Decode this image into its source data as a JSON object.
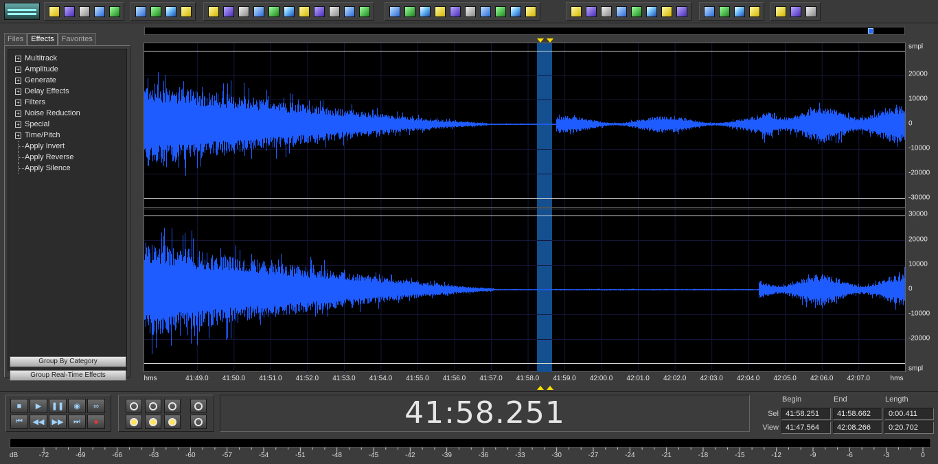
{
  "toolbar": {
    "groups": [
      {
        "icons": [
          "new-file-icon",
          "open-file-icon",
          "save-icon",
          "save-copy-icon",
          "save-all-icon"
        ]
      },
      {
        "icons": [
          "edit-waveform-icon",
          "paint-icon",
          "crop-icon",
          "mixdown-icon"
        ]
      },
      {
        "icons": [
          "envelope-icon",
          "undo-icon",
          "silence-icon",
          "marker-icon",
          "zero-crossing-icon",
          "snap-icon",
          "scan-icon",
          "level-icon",
          "normalize-icon",
          "pan-icon",
          "stretch-icon"
        ]
      },
      {
        "icons": [
          "eq-icon",
          "compressor-icon",
          "noise-icon",
          "echo-icon",
          "filter-icon",
          "reverb-icon",
          "delay-icon",
          "chorus-icon",
          "flanger-icon",
          "pitch-icon"
        ]
      },
      {
        "icons": [
          "spectrum-icon",
          "frequency-icon",
          "phase-icon",
          "analysis-icon",
          "statistics-icon",
          "cd-icon",
          "grid-icon",
          "metronome-icon"
        ]
      },
      {
        "icons": [
          "fx-insert-icon",
          "fx-rack-icon",
          "fx-chain-icon",
          "fx-preset-icon"
        ]
      },
      {
        "icons": [
          "cue-icon",
          "tempo-icon",
          "view-fit-icon"
        ]
      }
    ]
  },
  "panel": {
    "tabs": [
      {
        "label": "Files",
        "active": false
      },
      {
        "label": "Effects",
        "active": true
      },
      {
        "label": "Favorites",
        "active": false
      }
    ],
    "tree": [
      {
        "label": "Multitrack",
        "expandable": true
      },
      {
        "label": "Amplitude",
        "expandable": true
      },
      {
        "label": "Generate",
        "expandable": true
      },
      {
        "label": "Delay Effects",
        "expandable": true
      },
      {
        "label": "Filters",
        "expandable": true
      },
      {
        "label": "Noise Reduction",
        "expandable": true
      },
      {
        "label": "Special",
        "expandable": true
      },
      {
        "label": "Time/Pitch",
        "expandable": true
      },
      {
        "label": "Apply Invert",
        "expandable": false
      },
      {
        "label": "Apply Reverse",
        "expandable": false
      },
      {
        "label": "Apply Silence",
        "expandable": false
      }
    ],
    "buttons": {
      "group_by_category": "Group By Category",
      "group_realtime": "Group Real-Time Effects"
    }
  },
  "waveform": {
    "ruler_unit_left": "hms",
    "ruler_unit_right": "hms",
    "ruler_labels": [
      "41:49.0",
      "41:50.0",
      "41:51.0",
      "41:52.0",
      "41:53.0",
      "41:54.0",
      "41:55.0",
      "41:56.0",
      "41:57.0",
      "41:58.0",
      "41:59.0",
      "42:00.0",
      "42:01.0",
      "42:02.0",
      "42:03.0",
      "42:04.0",
      "42:05.0",
      "42:06.0",
      "42:07.0"
    ],
    "view_start_seconds": 47.564,
    "view_end_seconds": 68.266,
    "selection_start_seconds": 58.251,
    "selection_end_seconds": 58.662,
    "y_unit": "smpl",
    "channel1_ylabels": [
      "20000",
      "10000",
      "0",
      "-10000",
      "-20000",
      "-30000"
    ],
    "channel2_ylabels": [
      "30000",
      "20000",
      "10000",
      "0",
      "-10000",
      "-20000"
    ],
    "waveform_color": "#1f5cff",
    "selection_color": "#14508f"
  },
  "transport": {
    "timecode": "41:58.251"
  },
  "selection_info": {
    "headers": {
      "begin": "Begin",
      "end": "End",
      "length": "Length"
    },
    "sel": {
      "label": "Sel",
      "begin": "41:58.251",
      "end": "41:58.662",
      "length": "0:00.411"
    },
    "view": {
      "label": "View",
      "begin": "41:47.564",
      "end": "42:08.266",
      "length": "0:20.702"
    }
  },
  "meter": {
    "unit": "dB",
    "labels": [
      "-72",
      "-69",
      "-66",
      "-63",
      "-60",
      "-57",
      "-54",
      "-51",
      "-48",
      "-45",
      "-42",
      "-39",
      "-36",
      "-33",
      "-30",
      "-27",
      "-24",
      "-21",
      "-18",
      "-15",
      "-12",
      "-9",
      "-6",
      "-3",
      "0"
    ]
  }
}
